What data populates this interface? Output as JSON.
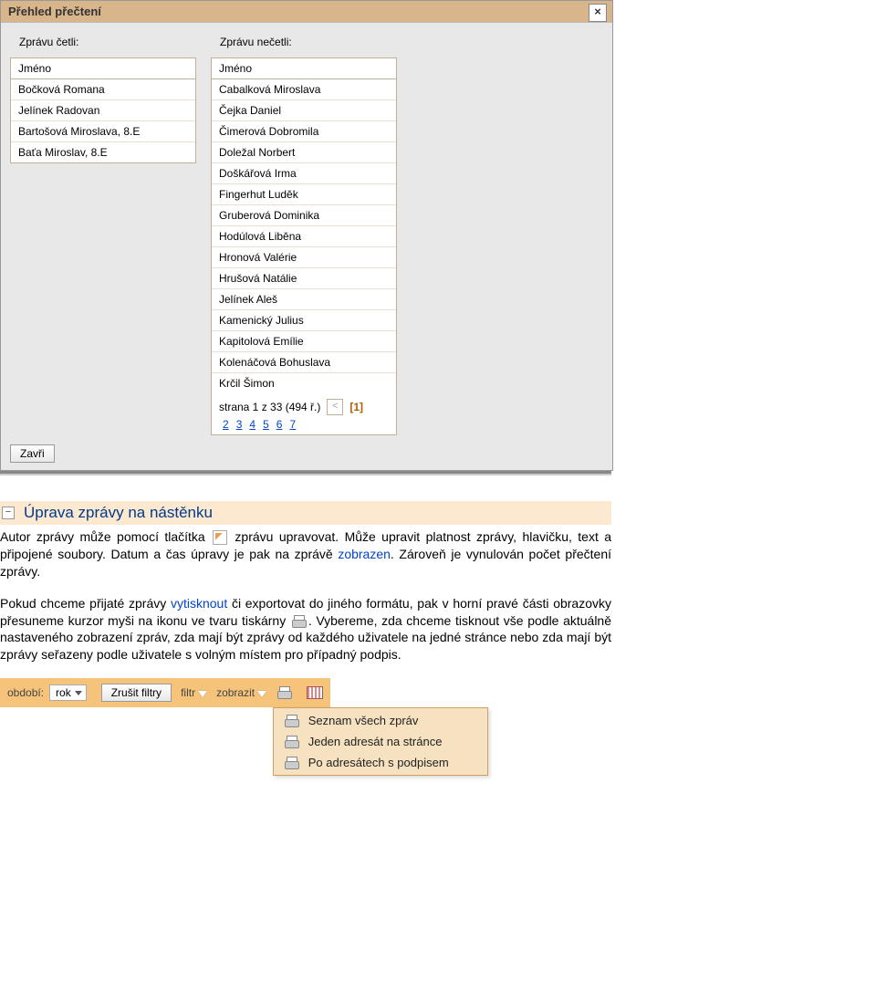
{
  "dialog": {
    "title": "Přehled přečtení",
    "close_label": "×",
    "read_label": "Zprávu četli:",
    "unread_label": "Zprávu nečetli:",
    "col_header": "Jméno",
    "read_list": [
      "Bočková Romana",
      "Jelínek Radovan",
      "Bartošová Miroslava, 8.E",
      "Baťa Miroslav, 8.E"
    ],
    "unread_list": [
      "Cabalková Miroslava",
      "Čejka Daniel",
      "Čimerová Dobromila",
      "Doležal Norbert",
      "Doškářová Irma",
      "Fingerhut Luděk",
      "Gruberová Dominika",
      "Hodúlová Liběna",
      "Hronová Valérie",
      "Hrušová Natálie",
      "Jelínek Aleš",
      "Kamenický Julius",
      "Kapitolová Emílie",
      "Kolenáčová Bohuslava",
      "Krčil Šimon"
    ],
    "pager": {
      "info": "strana 1 z 33 (494 ř.)",
      "prev": "<",
      "current": "[1]",
      "pages": [
        "2",
        "3",
        "4",
        "5",
        "6",
        "7"
      ]
    },
    "close_btn": "Zavři"
  },
  "doc": {
    "heading": "Úprava zprávy na nástěnku",
    "p1_a": "Autor zprávy může pomocí tlačítka ",
    "p1_b": " zprávu upravovat. Může upravit platnost zprávy, hlavičku, text a připojené soubory. Datum a čas úpravy je pak na zprávě ",
    "p1_link1": "zobrazen",
    "p1_c": ". Zároveň je vynulován počet přečtení zprávy.",
    "p2_a": "Pokud chceme přijaté zprávy ",
    "p2_link1": "vytisknout",
    "p2_b": " či exportovat do jiného formátu, pak v horní pravé části obrazovky přesuneme kurzor myši na ikonu ve tvaru tiskárny ",
    "p2_c": ". Vybereme, zda chceme tisknout vše podle aktuálně nastaveného zobrazení zpráv, zda mají být zprávy od každého uživatele na jedné stránce nebo zda mají být zprávy seřazeny podle uživatele s volným místem pro případný podpis."
  },
  "toolbar": {
    "period_label": "období:",
    "period_value": "rok",
    "cancel_filters": "Zrušit filtry",
    "filter_label": "filtr",
    "show_label": "zobrazit",
    "dropdown": [
      "Seznam všech zpráv",
      "Jeden adresát na stránce",
      "Po adresátech s podpisem"
    ]
  }
}
